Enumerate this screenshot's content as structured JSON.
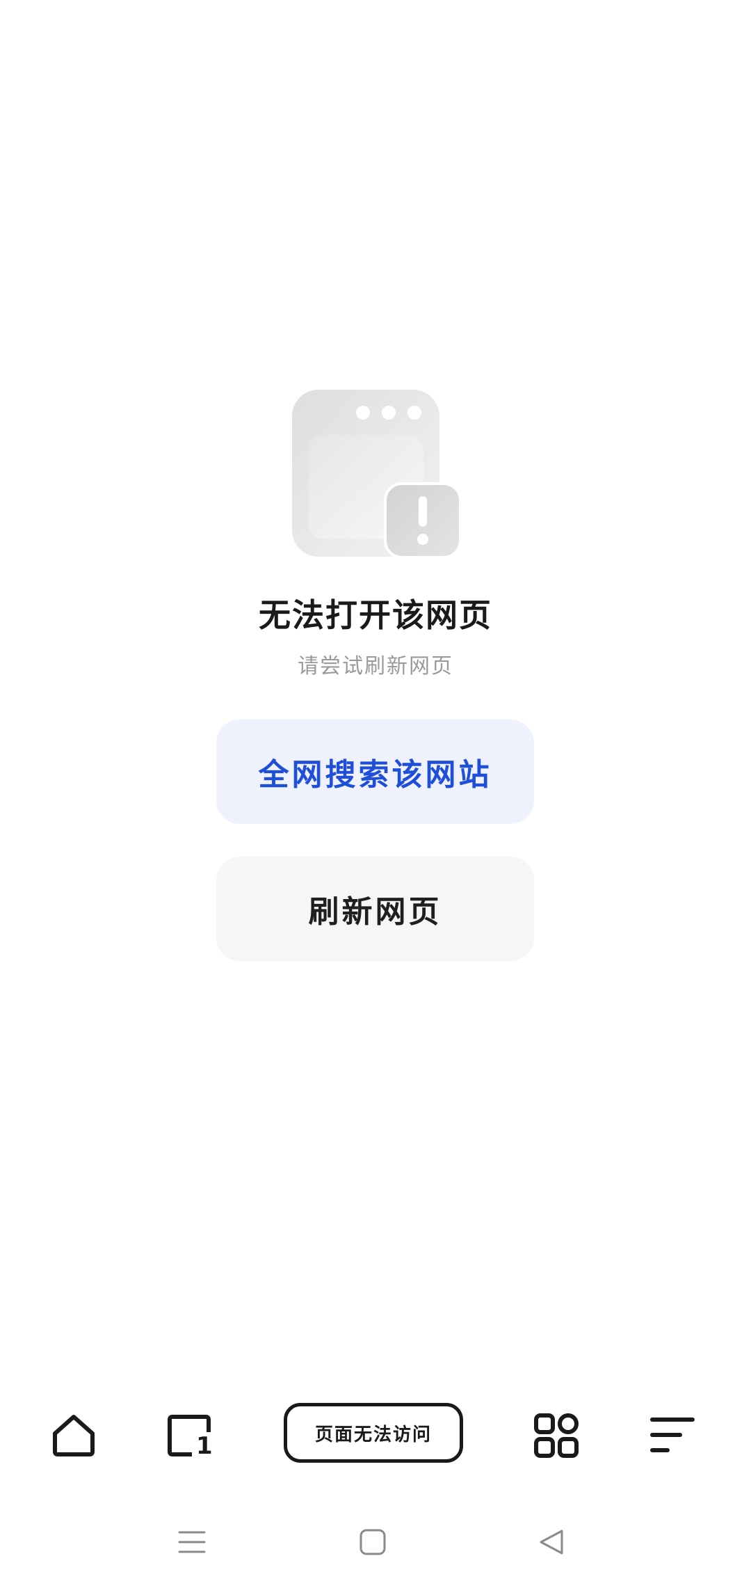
{
  "error": {
    "title": "无法打开该网页",
    "subtitle": "请尝试刷新网页"
  },
  "actions": {
    "search_label": "全网搜索该网站",
    "refresh_label": "刷新网页"
  },
  "toolbar": {
    "address_text": "页面无法访问",
    "tab_count": "1",
    "icons": [
      "home-icon",
      "tabs-icon",
      "apps-icon",
      "menu-icon"
    ]
  },
  "system_nav": {
    "icons": [
      "recents-icon",
      "home-nav-icon",
      "back-icon"
    ]
  },
  "colors": {
    "accent": "#1f4fd9",
    "search_button_bg": "#eff1fd",
    "refresh_button_bg": "#f6f6f6",
    "title": "#1a1a1a",
    "subtitle": "#9a9a9a"
  }
}
